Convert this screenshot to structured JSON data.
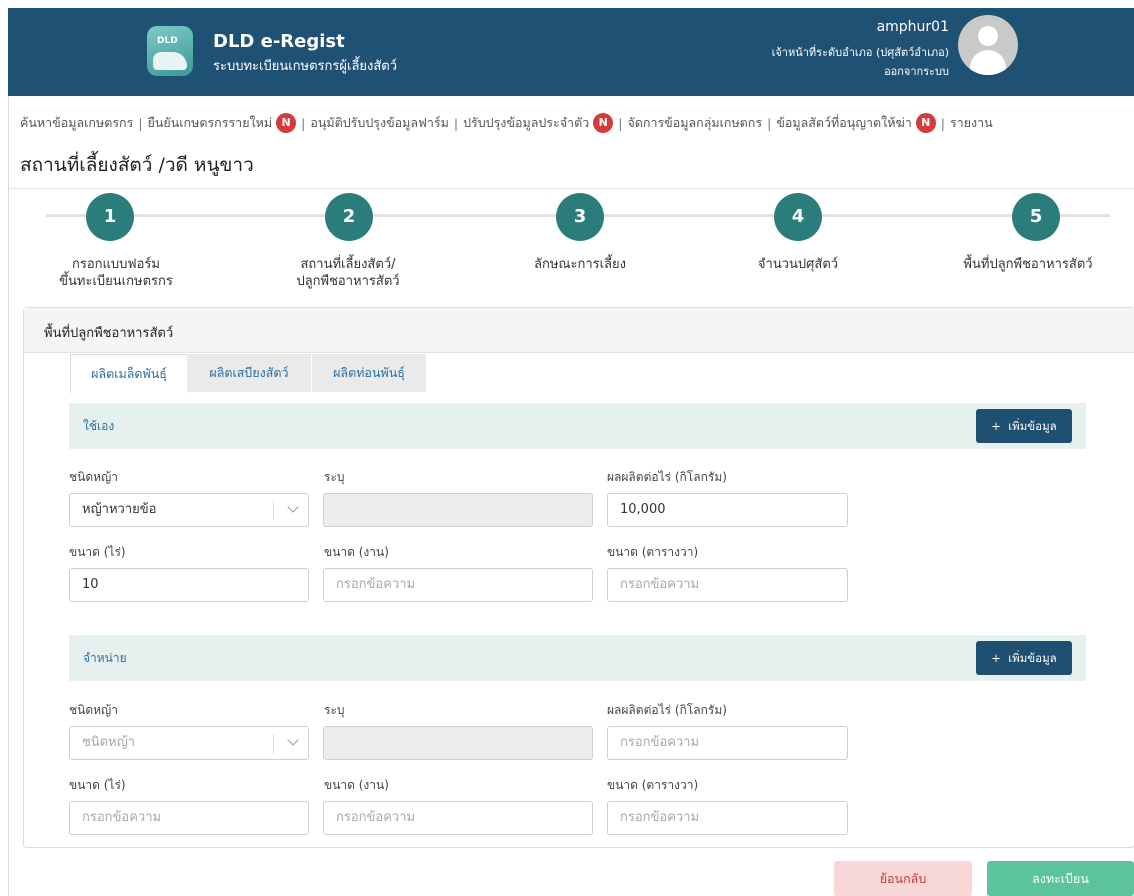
{
  "header": {
    "logo_text": "DLD",
    "app_title": "DLD e-Regist",
    "app_subtitle": "ระบบทะเบียนเกษตรกรผู้เลี้ยงสัตว์",
    "username": "amphur01",
    "role": "เจ้าหน้าที่ระดับอำเภอ (ปศุสัตว์อำเภอ)",
    "logout": "ออกจากระบบ"
  },
  "nav": {
    "items": [
      {
        "label": "ค้นหาข้อมูลเกษตรกร",
        "badge": ""
      },
      {
        "label": "ยืนยันเกษตรกรรายใหม่",
        "badge": "N"
      },
      {
        "label": "อนุมัติปรับปรุงข้อมูลฟาร์ม",
        "badge": ""
      },
      {
        "label": "ปรับปรุงข้อมูลประจำตัว",
        "badge": "N"
      },
      {
        "label": "จัดการข้อมูลกลุ่มเกษตกร",
        "badge": ""
      },
      {
        "label": "ข้อมูลสัตว์ที่อนุญาตให้ฆ่า",
        "badge": "N"
      },
      {
        "label": "รายงาน",
        "badge": ""
      }
    ],
    "separator": "|"
  },
  "page_title": "สถานที่เลี้ยงสัตว์ /วดี หนูขาว",
  "stepper": {
    "steps": [
      {
        "number": "1",
        "label_line1": "กรอกแบบฟอร์ม",
        "label_line2": "ขึ้นทะเบียนเกษตรกร"
      },
      {
        "number": "2",
        "label_line1": "สถานที่เลี้ยงสัตว์/",
        "label_line2": "ปลูกพืชอาหารสัตว์"
      },
      {
        "number": "3",
        "label_line1": "ลักษณะการเลี้ยง",
        "label_line2": ""
      },
      {
        "number": "4",
        "label_line1": "จำนวนปศุสัตว์",
        "label_line2": ""
      },
      {
        "number": "5",
        "label_line1": "พื้นที่ปลูกพืชอาหารสัตว์",
        "label_line2": ""
      }
    ]
  },
  "panel": {
    "title": "พื้นที่ปลูกพืชอาหารสัตว์",
    "tabs": [
      {
        "label": "ผลิตเมล็ดพันธุ์",
        "active": true
      },
      {
        "label": "ผลิตเสบียงสัตว์",
        "active": false
      },
      {
        "label": "ผลิตท่อนพันธุ์",
        "active": false
      }
    ],
    "add_button_label": "เพิ่มข้อมูล",
    "add_icon": "+",
    "sections": [
      {
        "title": "ใช้เอง",
        "grass_type_label": "ชนิดหญ้า",
        "grass_type_value": "หญ้าหวายข้อ",
        "specify_label": "ระบุ",
        "specify_value": "",
        "yield_label": "ผลผลิตต่อไร่ (กิโลกรัม)",
        "yield_value": "10,000",
        "rai_label": "ขนาด (ไร่)",
        "rai_value": "10",
        "ngan_label": "ขนาด (งาน)",
        "ngan_placeholder": "กรอกข้อความ",
        "wa_label": "ขนาด (ตารางวา)",
        "wa_placeholder": "กรอกข้อความ"
      },
      {
        "title": "จำหน่าย",
        "grass_type_label": "ชนิดหญ้า",
        "grass_type_placeholder": "ชนิดหญ้า",
        "specify_label": "ระบุ",
        "specify_value": "",
        "yield_label": "ผลผลิตต่อไร่ (กิโลกรัม)",
        "yield_placeholder": "กรอกข้อความ",
        "rai_label": "ขนาด (ไร่)",
        "rai_placeholder": "กรอกข้อความ",
        "ngan_label": "ขนาด (งาน)",
        "ngan_placeholder": "กรอกข้อความ",
        "wa_label": "ขนาด (ตารางวา)",
        "wa_placeholder": "กรอกข้อความ"
      }
    ]
  },
  "footer": {
    "back_label": "ย้อนกลับ",
    "submit_label": "ลงทะเบียน"
  },
  "colors": {
    "header_bg": "#1f5175",
    "step_circle": "#2a7d7a",
    "badge": "#d63a3a",
    "add_button": "#1f4f70",
    "section_bar": "#e6f0ef",
    "back_button": "#f8d7d9",
    "submit_button": "#5cc49a"
  },
  "icons": {
    "logo": "dld-cow-logo-icon",
    "avatar": "user-avatar-icon",
    "select": "chevron-down-icon",
    "add": "plus-icon"
  }
}
